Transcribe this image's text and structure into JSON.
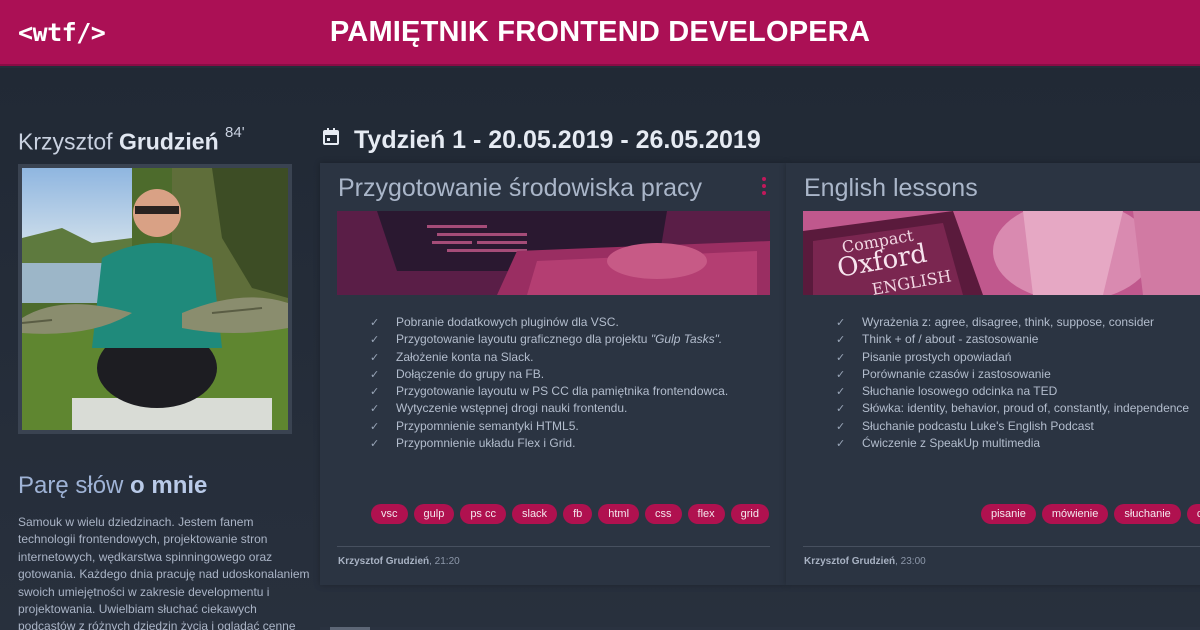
{
  "header": {
    "logo": "<wtf/>",
    "title": "PAMIĘTNIK FRONTEND DEVELOPERA"
  },
  "author": {
    "first_name": "Krzysztof",
    "last_name": "Grudzień",
    "year": "84'",
    "about_title_part1": "Parę słów",
    "about_title_part2": "o mnie",
    "about_text": "Samouk w wielu dziedzinach. Jestem fanem technologii frontendowych, projektowanie stron internetowych, wędkarstwa spinningowego oraz gotowania. Każdego dnia pracuję nad udoskonalaniem swoich umiejętności w zakresie developmentu i projektowania. Uwielbiam słuchać ciekawych podcastów z różnych dziedzin życia i oglądać cenne samouczki wideo. Po ciężkim dniu"
  },
  "week": {
    "icon": "calendar-icon",
    "title": "Tydzień 1 - 20.05.2019 - 26.05.2019"
  },
  "cards": [
    {
      "title": "Przygotowanie środowiska pracy",
      "tasks": [
        "Pobranie dodatkowych pluginów dla VSC.",
        "Przygotowanie layoutu graficznego dla projektu",
        "Założenie konta na Slack.",
        "Dołączenie do grupy na FB.",
        "Przygotowanie layoutu w PS CC dla pamiętnika frontendowca.",
        "Wytyczenie wstępnej drogi nauki frontendu.",
        "Przypomnienie semantyki HTML5.",
        "Przypomnienie układu Flex i Grid."
      ],
      "task2_italic": "\"Gulp Tasks\".",
      "tags": [
        "vsc",
        "gulp",
        "ps cc",
        "slack",
        "fb",
        "html",
        "css",
        "flex",
        "grid"
      ],
      "author": "Krzysztof Grudzień",
      "time": ", 21:20"
    },
    {
      "title": "English lessons",
      "tasks": [
        "Wyrażenia z: agree, disagree, think, suppose, consider",
        "Think + of / about - zastosowanie",
        "Pisanie prostych opowiadań",
        "Porównanie czasów i zastosowanie",
        "Słuchanie losowego odcinka na TED",
        "Słówka: identity, behavior, proud of, constantly, independence",
        "Słuchanie podcastu Luke's English Podcast",
        "Ćwiczenie z SpeakUp multimedia"
      ],
      "tags": [
        "pisanie",
        "mówienie",
        "słuchanie",
        "czytanie"
      ],
      "author": "Krzysztof Grudzień",
      "time": ", 23:00",
      "book_text_1": "Compact",
      "book_text_2": "Oxford",
      "book_text_3": "ENGLISH"
    }
  ],
  "colors": {
    "accent": "#ab1055",
    "tag": "#b0114f",
    "background": "#252d3a",
    "card": "#2b3442"
  }
}
